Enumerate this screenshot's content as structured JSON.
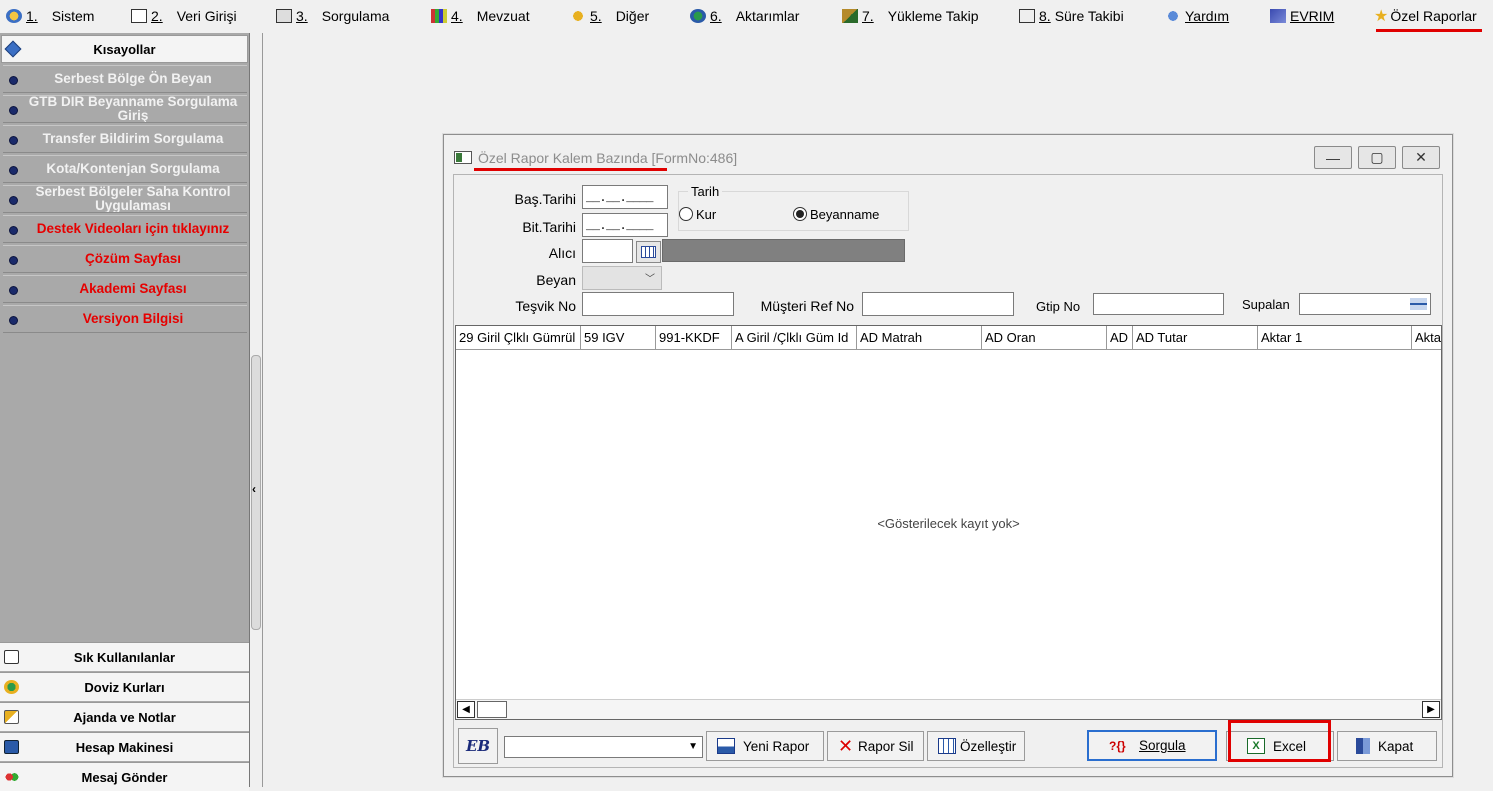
{
  "menu": {
    "items": [
      {
        "num": "1.",
        "label": "Sistem"
      },
      {
        "num": "2.",
        "label": "Veri Girişi"
      },
      {
        "num": "3.",
        "label": "Sorgulama"
      },
      {
        "num": "4.",
        "label": "Mevzuat"
      },
      {
        "num": "5.",
        "label": "Diğer"
      },
      {
        "num": "6.",
        "label": "Aktarımlar"
      },
      {
        "num": "7.",
        "label": "Yükleme Takip"
      },
      {
        "num": "8.",
        "label": "Süre Takibi"
      },
      {
        "num": "",
        "label": "Yardım"
      },
      {
        "num": "",
        "label": "EVRIM"
      },
      {
        "num": "",
        "label": "Özel Raporlar"
      }
    ]
  },
  "sidebar": {
    "header": "Kısayollar",
    "links": [
      {
        "label": "Serbest Bölge Ön Beyan",
        "red": false
      },
      {
        "label": "GTB DIR Beyanname Sorgulama Giriş",
        "red": false
      },
      {
        "label": "Transfer Bildirim Sorgulama",
        "red": false
      },
      {
        "label": "Kota/Kontenjan Sorgulama",
        "red": false
      },
      {
        "label": "Serbest Bölgeler Saha Kontrol Uygulaması",
        "red": false
      },
      {
        "label": "Destek Videoları için tıklayınız",
        "red": true
      },
      {
        "label": "Çözüm Sayfası",
        "red": true
      },
      {
        "label": "Akademi Sayfası",
        "red": true
      },
      {
        "label": "Versiyon Bilgisi",
        "red": true
      }
    ],
    "bottom": [
      {
        "label": "Sık Kullanılanlar",
        "icon": "favorites-icon"
      },
      {
        "label": "Doviz Kurları",
        "icon": "currency-icon"
      },
      {
        "label": "Ajanda ve Notlar",
        "icon": "agenda-icon"
      },
      {
        "label": "Hesap Makinesi",
        "icon": "calculator-icon"
      },
      {
        "label": "Mesaj Gönder",
        "icon": "message-icon"
      }
    ],
    "collapse_glyph": "‹"
  },
  "window": {
    "title": "Özel Rapor Kalem Bazında [FormNo:486]",
    "min": "—",
    "max": "▢",
    "close": "✕"
  },
  "form": {
    "bas_tarihi_label": "Baş.Tarihi",
    "bas_tarihi_value": "__.__.____",
    "bit_tarihi_label": "Bit.Tarihi",
    "bit_tarihi_value": "__.__.____",
    "tarih_group": "Tarih",
    "radio_kur": "Kur",
    "radio_beyanname": "Beyanname",
    "selected_radio": "Beyanname",
    "alici_label": "Alıcı",
    "beyan_label": "Beyan",
    "beyan_value": "",
    "tesvik_label": "Teşvik No",
    "musteri_label": "Müşteri Ref No",
    "gtip_label": "Gtip No",
    "supalan_label": "Supalan"
  },
  "grid": {
    "columns": [
      "29 Giril Çlklı Gümrül",
      "59 IGV",
      "991-KKDF",
      "A Giril /Çlklı Güm Id",
      "AD Matrah",
      "AD Oran",
      "AD",
      "AD Tutar",
      "Aktar 1",
      "Akta"
    ],
    "empty_text": "<Gösterilecek kayıt yok>"
  },
  "toolbar": {
    "logo_text": "EB",
    "combo_value": "",
    "yeni_rapor": "Yeni Rapor",
    "rapor_sil": "Rapor Sil",
    "ozellestir": "Özelleştir",
    "sorgula": "Sorgula",
    "sorgula_icon_text": "?{}",
    "excel": "Excel",
    "kapat": "Kapat"
  },
  "colors": {
    "highlight_red": "#e00000",
    "sidebar_bg": "#a9a9a9",
    "link_red": "#e60000",
    "accent_blue": "#2a6ecf"
  }
}
